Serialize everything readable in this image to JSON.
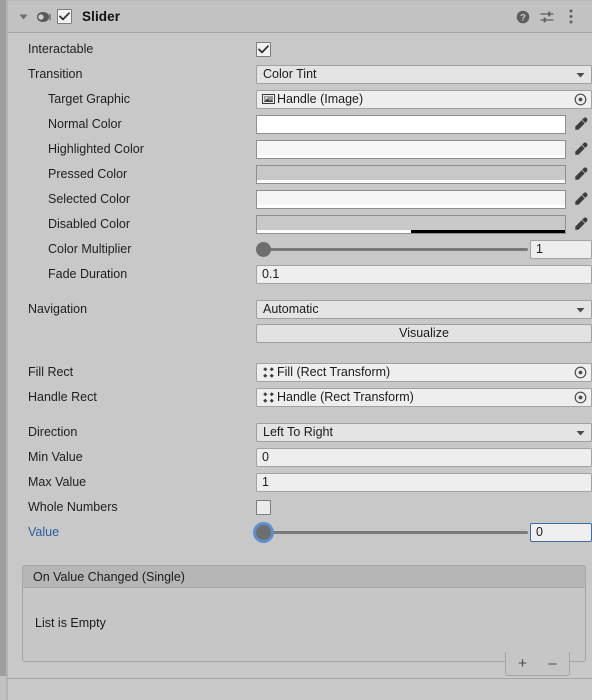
{
  "header": {
    "title": "Slider",
    "enabled_checkbox": true,
    "foldout_expanded": true,
    "icons": [
      "foldout-triangle",
      "eye-icon",
      "help-icon",
      "preset-icon",
      "more-menu-icon"
    ]
  },
  "colors": {
    "panel_bg": "#c8c8c8",
    "header_bg": "#c2c2c2",
    "field_bg": "#eeeeee",
    "accent_blue": "#2b5f9e",
    "focus_border": "#3b6ea8",
    "knob_ring": "#5b8fd0"
  },
  "properties": {
    "interactable": {
      "label": "Interactable",
      "value": true
    },
    "transition": {
      "label": "Transition",
      "value": "Color Tint"
    },
    "target_graphic": {
      "label": "Target Graphic",
      "value": "Handle (Image)",
      "icon": "image-component-icon"
    },
    "normal_color": {
      "label": "Normal Color",
      "swatch": "#ffffff",
      "alpha": 100
    },
    "highlighted_color": {
      "label": "Highlighted Color",
      "swatch": "#f5f5f5",
      "alpha": 100
    },
    "pressed_color": {
      "label": "Pressed Color",
      "swatch": "#c8c8c8",
      "alpha": 100
    },
    "selected_color": {
      "label": "Selected Color",
      "swatch": "#f5f5f5",
      "alpha": 100
    },
    "disabled_color": {
      "label": "Disabled Color",
      "swatch": "#c8c8c8",
      "alpha": 50
    },
    "color_multiplier": {
      "label": "Color Multiplier",
      "value": "1",
      "slider_pct": 0
    },
    "fade_duration": {
      "label": "Fade Duration",
      "value": "0.1"
    },
    "navigation": {
      "label": "Navigation",
      "value": "Automatic"
    },
    "visualize": {
      "label": "Visualize"
    },
    "fill_rect": {
      "label": "Fill Rect",
      "value": "Fill (Rect Transform)",
      "icon": "rect-transform-icon"
    },
    "handle_rect": {
      "label": "Handle Rect",
      "value": "Handle (Rect Transform)",
      "icon": "rect-transform-icon"
    },
    "direction": {
      "label": "Direction",
      "value": "Left To Right"
    },
    "min_value": {
      "label": "Min Value",
      "value": "0"
    },
    "max_value": {
      "label": "Max Value",
      "value": "1"
    },
    "whole_numbers": {
      "label": "Whole Numbers",
      "value": false
    },
    "value": {
      "label": "Value",
      "value": "0",
      "slider_pct": 0,
      "modified": true
    }
  },
  "event_list": {
    "title": "On Value Changed (Single)",
    "empty_text": "List is Empty",
    "add_label": "+",
    "remove_label": "–"
  }
}
